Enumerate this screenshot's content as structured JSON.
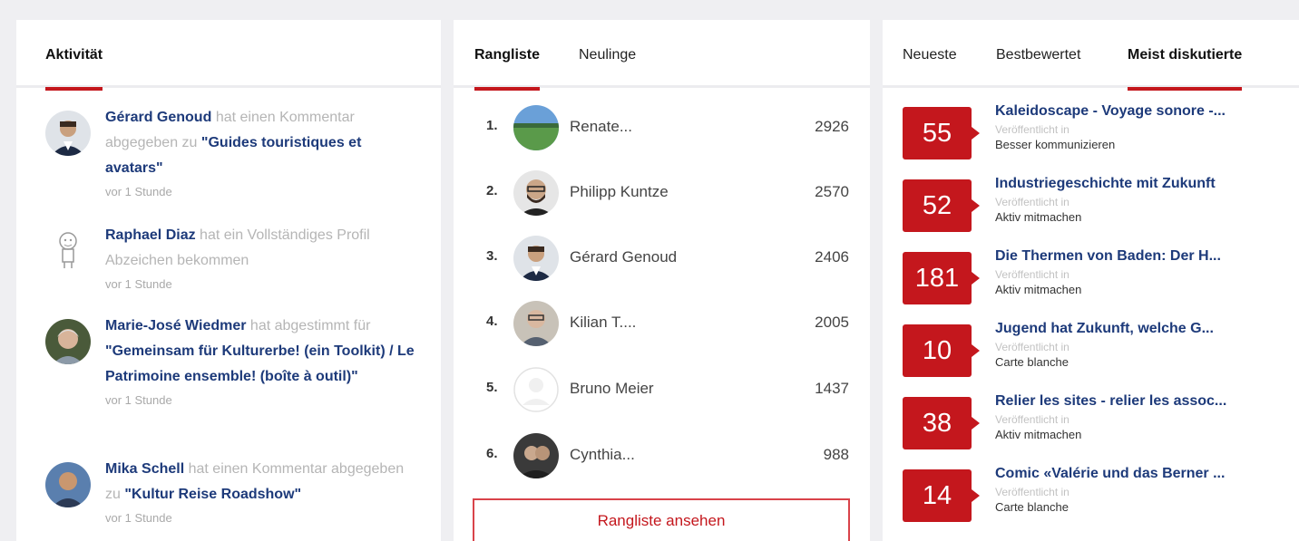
{
  "activity": {
    "tab": "Aktivität",
    "items": [
      {
        "user": "Gérard Genoud",
        "action": "hat einen Kommentar abgegeben zu",
        "object": "\"Guides touristiques et avatars\"",
        "time": "vor 1 Stunde"
      },
      {
        "user": "Raphael Diaz",
        "action": "hat ein Vollständiges Profil Abzeichen bekommen",
        "object": "",
        "time": "vor 1 Stunde"
      },
      {
        "user": "Marie-José Wiedmer",
        "action": "hat abgestimmt für",
        "object": "\"Gemeinsam für Kulturerbe! (ein Toolkit) / Le Patrimoine ensemble! (boîte à outil)\"",
        "time": "vor 1 Stunde"
      },
      {
        "user": "Mika Schell",
        "action": "hat einen Kommentar abgegeben zu",
        "object": "\"Kultur Reise Roadshow\"",
        "time": "vor 1 Stunde"
      }
    ]
  },
  "ranking": {
    "tabs": [
      "Rangliste",
      "Neulinge"
    ],
    "rows": [
      {
        "rank": "1.",
        "name": "Renate...",
        "score": "2926"
      },
      {
        "rank": "2.",
        "name": "Philipp Kuntze",
        "score": "2570"
      },
      {
        "rank": "3.",
        "name": "Gérard Genoud",
        "score": "2406"
      },
      {
        "rank": "4.",
        "name": "Kilian T....",
        "score": "2005"
      },
      {
        "rank": "5.",
        "name": "Bruno Meier",
        "score": "1437"
      },
      {
        "rank": "6.",
        "name": "Cynthia...",
        "score": "988"
      }
    ],
    "button": "Rangliste ansehen"
  },
  "discussions": {
    "tabs": [
      "Neueste",
      "Bestbewertet",
      "Meist diskutierte"
    ],
    "published_label": "Veröffentlicht in",
    "items": [
      {
        "count": "55",
        "title": "Kaleidoscape - Voyage sonore -...",
        "category": "Besser kommunizieren"
      },
      {
        "count": "52",
        "title": "Industriegeschichte mit Zukunft",
        "category": "Aktiv mitmachen"
      },
      {
        "count": "181",
        "title": "Die Thermen von Baden: Der H...",
        "category": "Aktiv mitmachen"
      },
      {
        "count": "10",
        "title": "Jugend hat Zukunft, welche G...",
        "category": "Carte blanche"
      },
      {
        "count": "38",
        "title": "Relier les sites - relier les assoc...",
        "category": "Aktiv mitmachen"
      },
      {
        "count": "14",
        "title": "Comic «Valérie und das Berner ...",
        "category": "Carte blanche"
      }
    ]
  },
  "colors": {
    "accent": "#c4171d",
    "link": "#1d3a7a",
    "background": "#efeff2"
  }
}
